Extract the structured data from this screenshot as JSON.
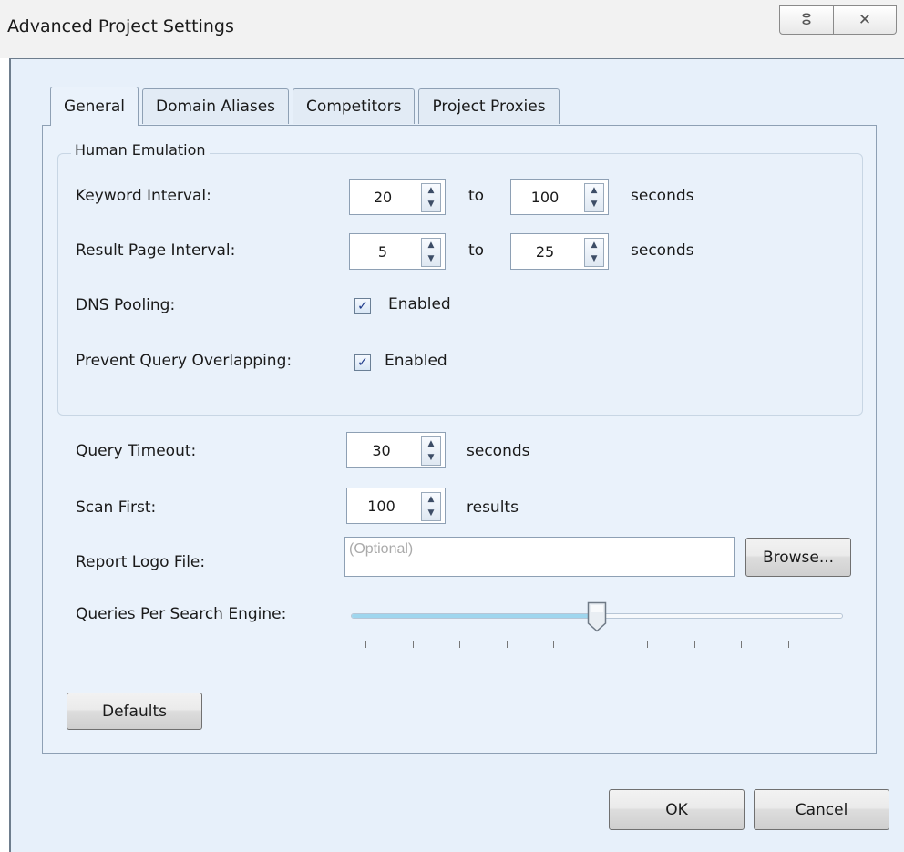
{
  "window": {
    "title": "Advanced Project Settings",
    "help_glyph": "ⵓ",
    "close_glyph": "✕"
  },
  "tabs": [
    {
      "label": "General",
      "active": true
    },
    {
      "label": "Domain Aliases",
      "active": false
    },
    {
      "label": "Competitors",
      "active": false
    },
    {
      "label": "Project Proxies",
      "active": false
    }
  ],
  "human_emulation": {
    "legend": "Human Emulation",
    "keyword_interval": {
      "label": "Keyword Interval:",
      "from": "20",
      "to_label": "to",
      "to": "100",
      "unit": "seconds"
    },
    "result_page_interval": {
      "label": "Result Page Interval:",
      "from": "5",
      "to_label": "to",
      "to": "25",
      "unit": "seconds"
    },
    "dns_pooling": {
      "label": "DNS Pooling:",
      "checkbox_label": "Enabled",
      "checked": true
    },
    "prevent_query_overlapping": {
      "label": "Prevent Query Overlapping:",
      "checkbox_label": "Enabled",
      "checked": true
    }
  },
  "query_timeout": {
    "label": "Query Timeout:",
    "value": "30",
    "unit": "seconds"
  },
  "scan_first": {
    "label": "Scan First:",
    "value": "100",
    "unit": "results"
  },
  "report_logo": {
    "label": "Report Logo File:",
    "placeholder": "(Optional)",
    "browse_label": "Browse..."
  },
  "queries_per_engine": {
    "label": "Queries Per Search Engine:",
    "level_fraction": 0.5,
    "tick_count": 10
  },
  "buttons": {
    "defaults": "Defaults",
    "ok": "OK",
    "cancel": "Cancel"
  },
  "colors": {
    "client_bg": "#e7f0fa",
    "slider_fill": "#9fd6ee",
    "check": "#1e3a8a"
  }
}
